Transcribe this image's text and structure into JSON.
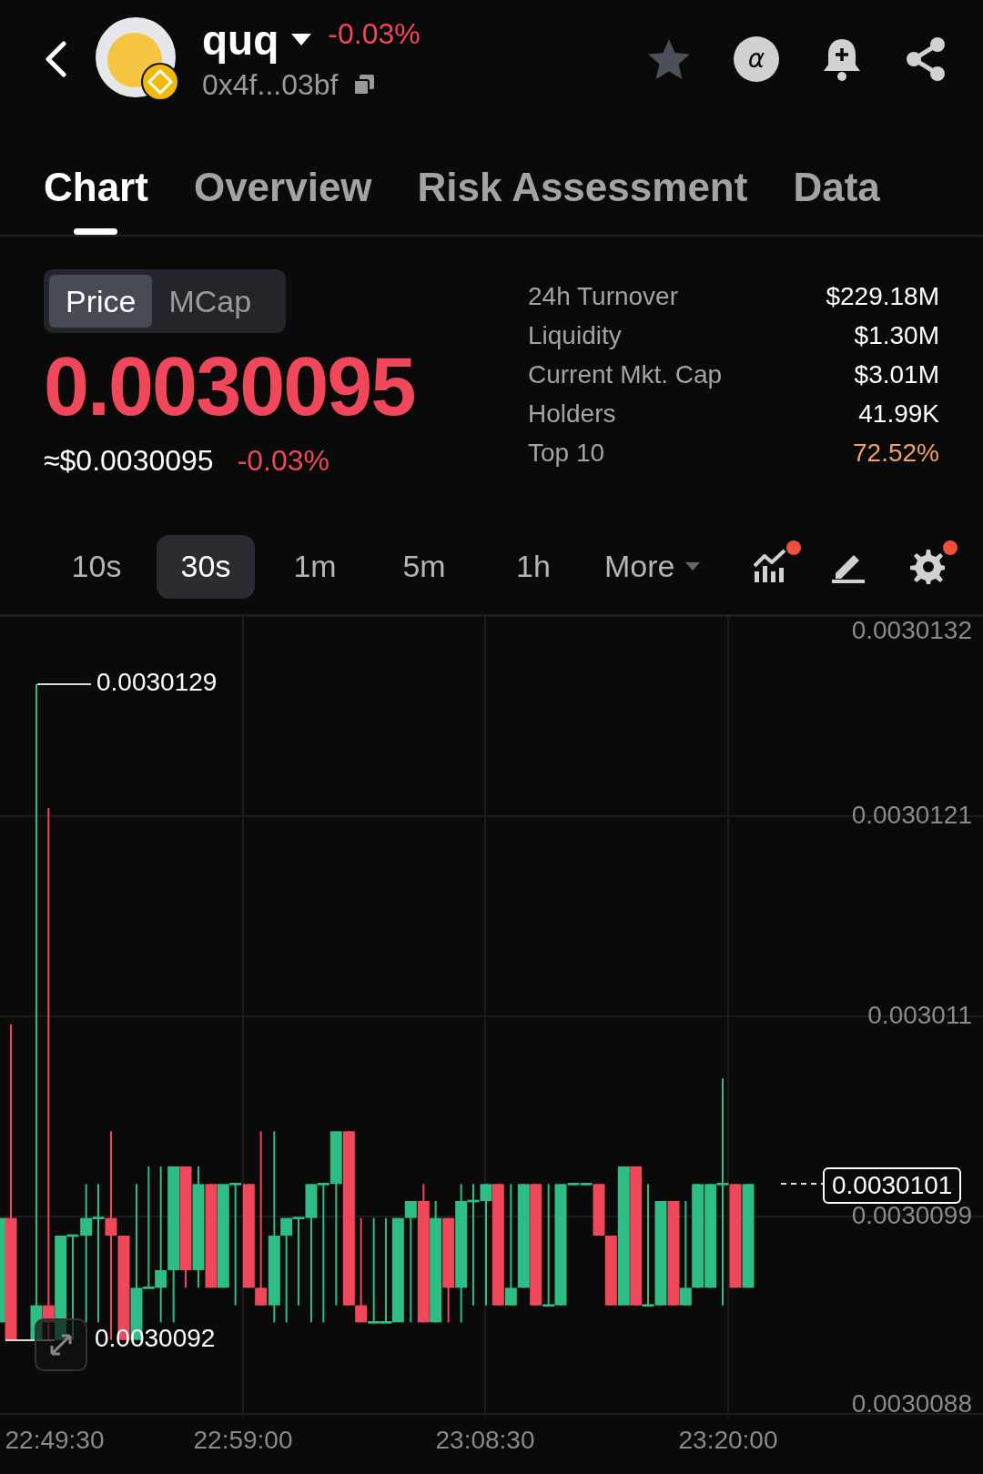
{
  "header": {
    "symbol": "quq",
    "change": "-0.03%",
    "address": "0x4f...03bf",
    "alpha": "α"
  },
  "tabs": [
    {
      "label": "Chart",
      "selected": true
    },
    {
      "label": "Overview",
      "selected": false
    },
    {
      "label": "Risk Assessment",
      "selected": false
    },
    {
      "label": "Data",
      "selected": false
    }
  ],
  "mode_toggle": [
    {
      "label": "Price",
      "selected": true
    },
    {
      "label": "MCap",
      "selected": false
    }
  ],
  "price": {
    "value": "0.0030095",
    "usd": "≈$0.0030095",
    "change": "-0.03%"
  },
  "stats": [
    {
      "label": "24h Turnover",
      "value": "$229.18M",
      "color": "#ffffff"
    },
    {
      "label": "Liquidity",
      "value": "$1.30M",
      "color": "#ffffff"
    },
    {
      "label": "Current Mkt. Cap",
      "value": "$3.01M",
      "color": "#ffffff"
    },
    {
      "label": "Holders",
      "value": "41.99K",
      "color": "#ffffff"
    },
    {
      "label": "Top 10",
      "value": "72.52%",
      "color": "#f4a261"
    }
  ],
  "intervals": [
    {
      "label": "10s",
      "selected": false
    },
    {
      "label": "30s",
      "selected": true
    },
    {
      "label": "1m",
      "selected": false
    },
    {
      "label": "5m",
      "selected": false
    },
    {
      "label": "1h",
      "selected": false
    }
  ],
  "more": {
    "label": "More"
  },
  "tools": [
    {
      "kind": "indicators",
      "dot": true
    },
    {
      "kind": "draw",
      "dot": false
    },
    {
      "kind": "settings",
      "dot": true
    }
  ],
  "chart": {
    "y_labels": [
      "0.0030132",
      "0.0030121",
      "0.003011",
      "0.0030099",
      "0.0030088"
    ],
    "x_labels": [
      "22:49:30",
      "22:59:00",
      "23:08:30",
      "23:20:00"
    ],
    "high_label": "0.0030129",
    "low_label": "0.0030092",
    "last_price": "0.0030101"
  }
}
